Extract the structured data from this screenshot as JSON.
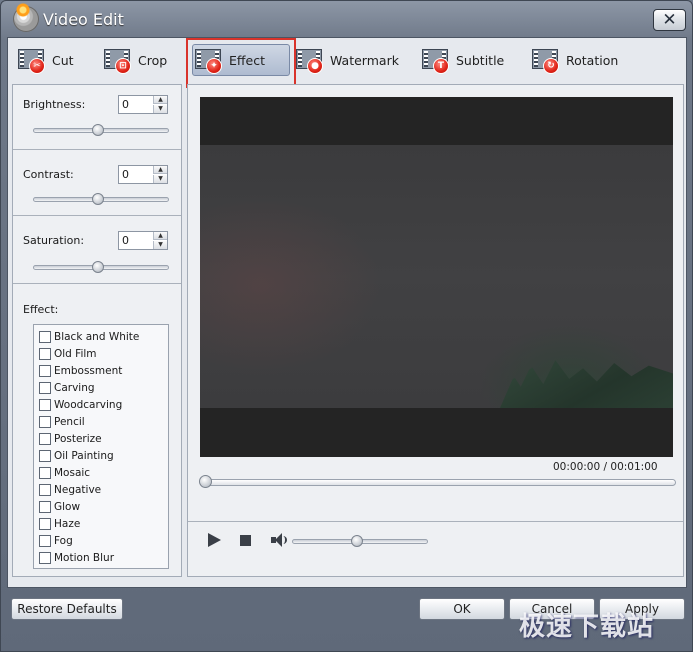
{
  "window": {
    "title": "Video Edit"
  },
  "toolbar": {
    "items": [
      {
        "label": "Cut"
      },
      {
        "label": "Crop"
      },
      {
        "label": "Effect"
      },
      {
        "label": "Watermark"
      },
      {
        "label": "Subtitle"
      },
      {
        "label": "Rotation"
      }
    ],
    "active": "Effect"
  },
  "adjustments": {
    "brightness": {
      "label": "Brightness:",
      "value": "0",
      "level": 0.5
    },
    "contrast": {
      "label": "Contrast:",
      "value": "0",
      "level": 0.5
    },
    "saturation": {
      "label": "Saturation:",
      "value": "0",
      "level": 0.5
    }
  },
  "effects": {
    "label": "Effect:",
    "items": [
      "Black and White",
      "Old Film",
      "Embossment",
      "Carving",
      "Woodcarving",
      "Pencil",
      "Posterize",
      "Oil Painting",
      "Mosaic",
      "Negative",
      "Glow",
      "Haze",
      "Fog",
      "Motion Blur"
    ]
  },
  "player": {
    "current_time": "00:00:00",
    "total_time": "00:01:00",
    "time_separator": "/",
    "progress": 0,
    "volume": 0.5
  },
  "buttons": {
    "restore": "Restore Defaults",
    "ok": "OK",
    "cancel": "Cancel",
    "apply": "Apply"
  },
  "watermark": "极速下载站",
  "colors": {
    "highlight": "#d9332b",
    "video_bg": "#242424"
  }
}
